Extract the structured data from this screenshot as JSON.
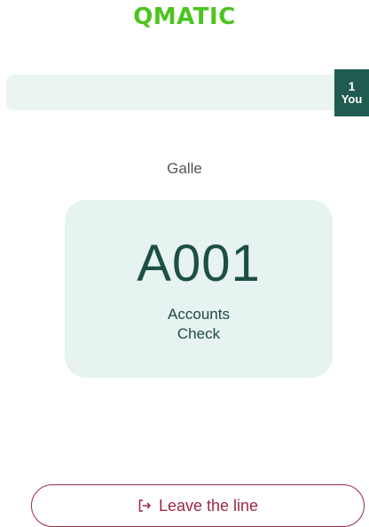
{
  "header": {
    "logo_text": "QMATIC",
    "logo_color": "#4ec41e"
  },
  "queue": {
    "position": "1",
    "position_label": "You"
  },
  "branch": {
    "name": "Galle"
  },
  "ticket": {
    "number": "A001",
    "service_line1": "Accounts",
    "service_line2": "Check"
  },
  "actions": {
    "leave_label": "Leave the line",
    "leave_icon": "exit-icon",
    "accent_color": "#9b2746"
  }
}
